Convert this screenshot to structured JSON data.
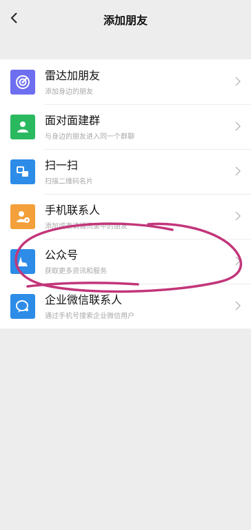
{
  "header": {
    "title": "添加朋友"
  },
  "items": [
    {
      "label": "雷达加朋友",
      "sub": "添加身边的朋友",
      "icon": "radar-icon",
      "color": "#6e6ef0"
    },
    {
      "label": "面对面建群",
      "sub": "与身边的朋友进入同一个群聊",
      "icon": "group-icon",
      "color": "#2bb960"
    },
    {
      "label": "扫一扫",
      "sub": "扫描二维码名片",
      "icon": "scan-icon",
      "color": "#2d8ce8"
    },
    {
      "label": "手机联系人",
      "sub": "添加或邀请通讯录中的朋友",
      "icon": "phone-contact-icon",
      "color": "#f3a03a"
    },
    {
      "label": "公众号",
      "sub": "获取更多资讯和服务",
      "icon": "official-account-icon",
      "color": "#2d8ce8"
    },
    {
      "label": "企业微信联系人",
      "sub": "通过手机号搜索企业微信用户",
      "icon": "wecom-icon",
      "color": "#2d8ce8"
    }
  ],
  "annotation_color": "#c2367a"
}
